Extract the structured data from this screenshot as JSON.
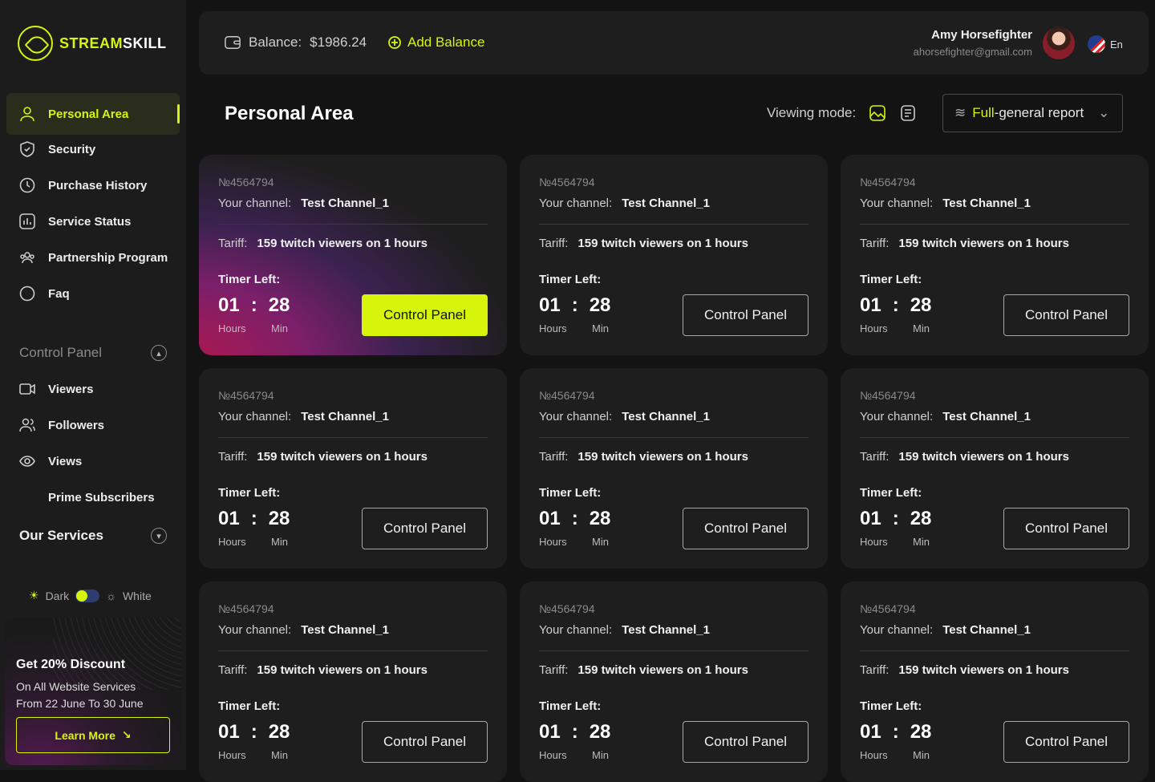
{
  "brand": {
    "name_accent": "STREAM",
    "name_rest": "SKILL"
  },
  "sidebar": {
    "items": [
      {
        "label": "Personal Area",
        "icon": "user-icon"
      },
      {
        "label": "Security",
        "icon": "shield-icon"
      },
      {
        "label": "Purchase History",
        "icon": "clock-icon"
      },
      {
        "label": "Service Status",
        "icon": "chart-icon"
      },
      {
        "label": "Partnership Program",
        "icon": "group-icon"
      },
      {
        "label": "Faq",
        "icon": "circle-icon"
      }
    ],
    "control_panel_title": "Control Panel",
    "control_items": [
      {
        "label": "Viewers",
        "icon": "video-icon"
      },
      {
        "label": "Followers",
        "icon": "users-icon"
      },
      {
        "label": "Views",
        "icon": "eye-icon"
      },
      {
        "label": "Prime Subscribers",
        "icon": ""
      }
    ],
    "services_title": "Our Services",
    "theme": {
      "dark": "Dark",
      "white": "White"
    },
    "promo": {
      "title": "Get 20% Discount",
      "line1": "On All Website Services",
      "line2": "From 22 June To 30 June",
      "button": "Learn More"
    }
  },
  "topbar": {
    "balance_label": "Balance:",
    "balance_value": "$1986.24",
    "add_balance": "Add Balance",
    "user_name": "Amy Horsefighter",
    "user_email": "ahorsefighter@gmail.com",
    "language": "En"
  },
  "page": {
    "title": "Personal Area",
    "viewing_mode_label": "Viewing mode:",
    "report_hl": "Full",
    "report_rest": "-general report"
  },
  "card_template": {
    "number": "№4564794",
    "channel_label": "Your channel:",
    "channel_value": "Test Channel_1",
    "tariff_label": "Tariff:",
    "tariff_value": "159 twitch viewers on 1 hours",
    "timer_label": "Timer Left:",
    "hours": "01",
    "sep": ":",
    "minutes": "28",
    "hours_unit": "Hours",
    "min_unit": "Min",
    "button": "Control Panel"
  },
  "colors": {
    "accent": "#d7f50a",
    "background": "#131313",
    "card": "#1e1e1e"
  }
}
